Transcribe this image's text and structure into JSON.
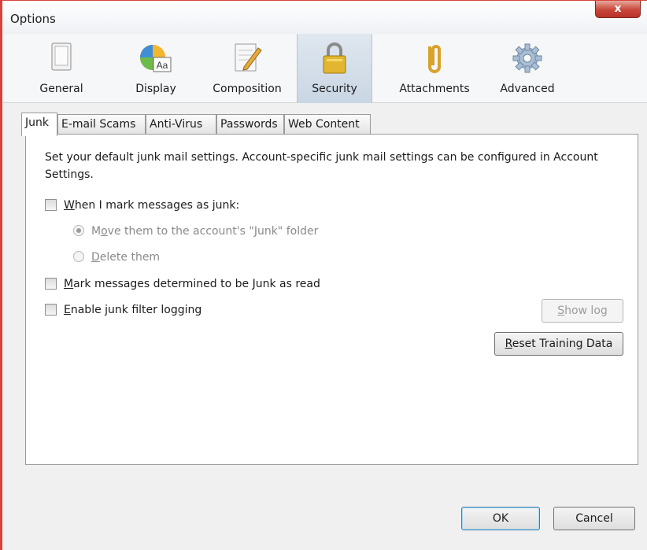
{
  "window": {
    "title": "Options",
    "close_label": "x"
  },
  "toolbar": {
    "panes": [
      {
        "label": "General"
      },
      {
        "label": "Display"
      },
      {
        "label": "Composition"
      },
      {
        "label": "Security"
      },
      {
        "label": "Attachments"
      },
      {
        "label": "Advanced"
      }
    ],
    "selected": "Security"
  },
  "tabs": [
    {
      "label": "Junk"
    },
    {
      "label": "E-mail Scams"
    },
    {
      "label": "Anti-Virus"
    },
    {
      "label": "Passwords"
    },
    {
      "label": "Web Content"
    }
  ],
  "junk": {
    "description": "Set your default junk mail settings. Account-specific junk mail settings can be configured in Account Settings.",
    "mark_junk": {
      "pre": "",
      "key": "W",
      "post": "hen I mark messages as junk:",
      "checked": false
    },
    "move_option": {
      "pre": "M",
      "key": "o",
      "post": "ve them to the account's \"Junk\" folder",
      "selected": true
    },
    "delete_option": {
      "pre": "",
      "key": "D",
      "post": "elete them",
      "selected": false
    },
    "mark_read": {
      "pre": "",
      "key": "M",
      "post": "ark messages determined to be Junk as read",
      "checked": false
    },
    "logging": {
      "pre": "",
      "key": "E",
      "post": "nable junk filter logging",
      "checked": false
    },
    "show_log": {
      "pre": "",
      "key": "S",
      "post": "how log"
    },
    "reset": {
      "pre": "",
      "key": "R",
      "post": "eset Training Data"
    }
  },
  "footer": {
    "ok_label": "OK",
    "cancel_label": "Cancel"
  }
}
